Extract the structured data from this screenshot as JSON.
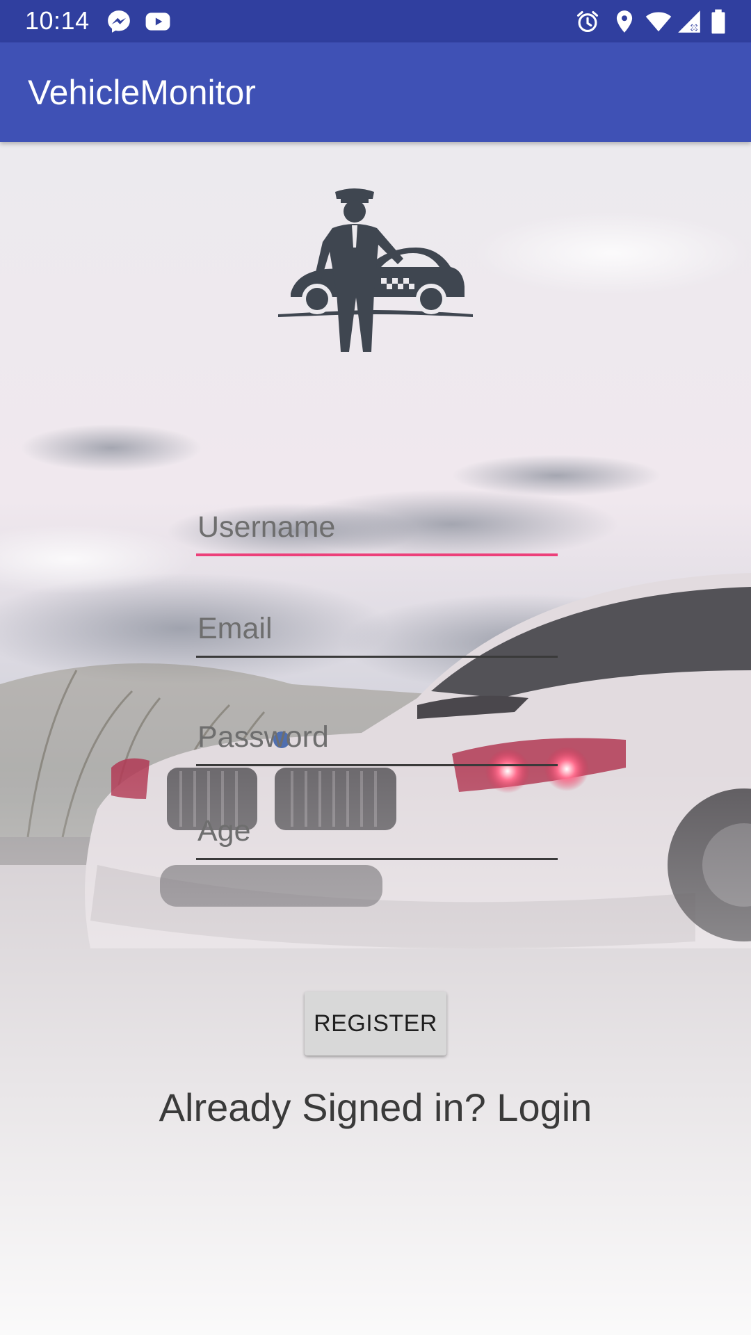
{
  "status_bar": {
    "time": "10:14",
    "left_icons": [
      "messenger-icon",
      "youtube-icon"
    ],
    "right_icons": [
      "alarm-icon",
      "location-icon",
      "wifi-icon",
      "cell-signal-icon",
      "battery-icon"
    ]
  },
  "app_bar": {
    "title": "VehicleMonitor"
  },
  "logo": {
    "icon": "chauffeur-taxi-icon"
  },
  "form": {
    "username": {
      "placeholder": "Username",
      "value": ""
    },
    "email": {
      "placeholder": "Email",
      "value": ""
    },
    "password": {
      "placeholder": "Password",
      "value": ""
    },
    "age": {
      "placeholder": "Age",
      "value": ""
    }
  },
  "register_button": {
    "label": "REGISTER"
  },
  "login_link": {
    "text": "Already Signed in? Login"
  },
  "colors": {
    "status_bar": "#303f9f",
    "app_bar": "#3f51b5",
    "accent": "#ec407a",
    "button": "#d8d8d8"
  }
}
